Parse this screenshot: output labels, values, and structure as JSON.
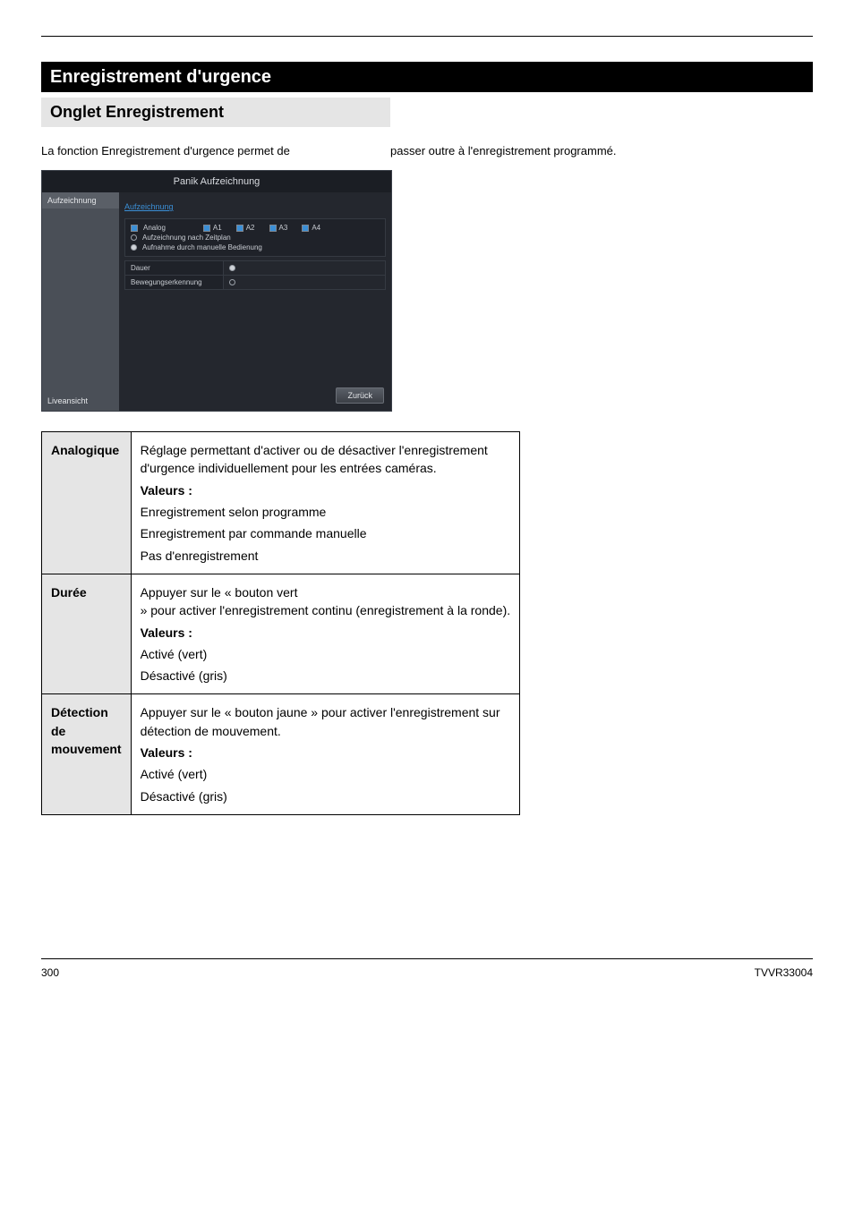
{
  "titlebar": {
    "title": "Enregistrement d'urgence"
  },
  "subtitle_block": {
    "heading": "Onglet Enregistrement"
  },
  "intro": {
    "lead": "La fonction Enregistrement d'urgence permet de",
    "rest": " passer outre à l'enregistrement programmé."
  },
  "screenshot": {
    "title": "Panik Aufzeichnung",
    "left_top": "Aufzeichnung",
    "left_bottom": "Liveansicht",
    "tab_label": "Aufzeichnung",
    "row_analog": "Analog",
    "channels": [
      "A1",
      "A2",
      "A3",
      "A4"
    ],
    "row_schedule": "Aufzeichnung nach Zeitplan",
    "row_manual": "Aufnahme durch manuelle Bedienung",
    "row_dauer": "Dauer",
    "row_motion": "Bewegungserkennung",
    "back_btn": "Zurück"
  },
  "opts": {
    "analog": {
      "title": "Analogique",
      "desc": "Réglage permettant d'activer ou de désactiver l'enregistrement d'urgence individuellement pour les entrées caméras.",
      "values_header": "Valeurs :",
      "v1_lead": "Enregistrement selon",
      "v1_rest": "programme",
      "v2_lead": "Enregistrement par",
      "v2_rest": "commande manuelle",
      "v3": "Pas d'enregistrement"
    },
    "duration": {
      "title": "Durée",
      "desc_lead": "Appuyer sur le « ",
      "desc_mid": "bouton vert",
      "desc_rest": " » pour activer l'enregistrement continu (enregistrement à la ronde).",
      "values_header": "Valeurs :",
      "v1": "Activé (vert)",
      "v2": "Désactivé (gris)"
    },
    "motion": {
      "title": "Détection de mouvement",
      "desc_lead": "Appuyer sur le « ",
      "desc_mid": "bouton jaune",
      "desc_rest": " » pour activer l'enregistrement sur détection de mouvement.",
      "values_header": "Valeurs :",
      "v1": "Activé (vert)",
      "v2": "Désactivé (gris)"
    }
  },
  "footer": {
    "pagenum": "300",
    "product": "TVVR33004"
  }
}
